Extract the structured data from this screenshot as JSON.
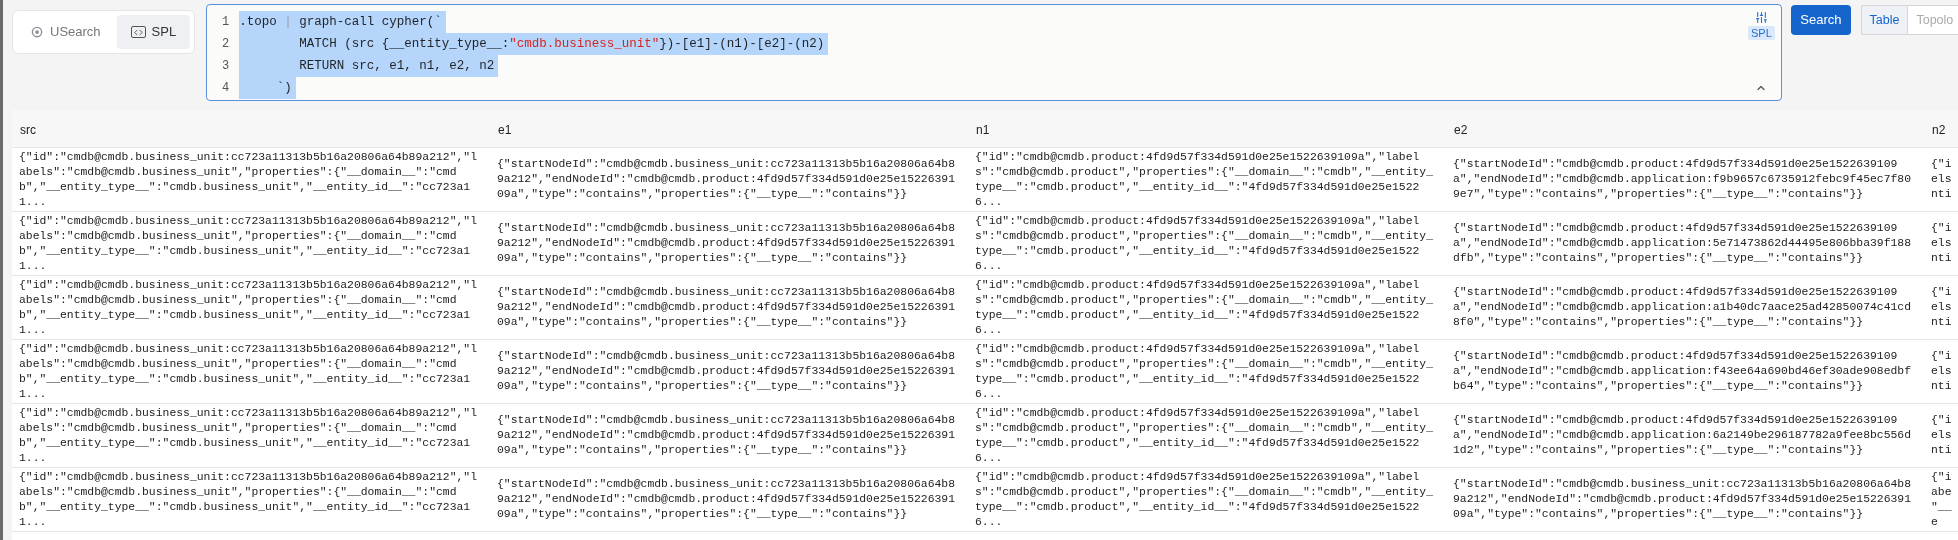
{
  "mode_tabs": [
    {
      "label": "USearch",
      "selected": false
    },
    {
      "label": "SPL",
      "selected": true
    }
  ],
  "editor": {
    "selected": true,
    "badge": "SPL",
    "line_numbers": [
      "1",
      "2",
      "3",
      "4"
    ],
    "lines": [
      [
        {
          "kind": "plain",
          "text": ".topo "
        },
        {
          "kind": "muted",
          "text": "|"
        },
        {
          "kind": "plain",
          "text": " graph-call cypher(`"
        }
      ],
      [
        {
          "kind": "plain",
          "text": "        MATCH (src {__entity_type__:"
        },
        {
          "kind": "string",
          "text": "\"cmdb.business_unit\""
        },
        {
          "kind": "plain",
          "text": "})-[e1]-(n1)-[e2]-(n2)"
        }
      ],
      [
        {
          "kind": "plain",
          "text": "        RETURN src, e1, n1, e2, n2"
        }
      ],
      [
        {
          "kind": "plain",
          "text": "     `)"
        }
      ]
    ]
  },
  "search_button": "Search",
  "view_tabs": [
    {
      "label": "Table",
      "selected": true
    },
    {
      "label": "Topolo",
      "selected": false
    }
  ],
  "table": {
    "columns": [
      "src",
      "e1",
      "n1",
      "e2",
      "n2"
    ],
    "rows": [
      [
        "{\"id\":\"cmdb@cmdb.business_unit:cc723a11313b5b16a20806a64b89a212\",\"labels\":\"cmdb@cmdb.business_unit\",\"properties\":{\"__domain__\":\"cmdb\",\"__entity_type__\":\"cmdb.business_unit\",\"__entity_id__\":\"cc723a11...",
        "{\"startNodeId\":\"cmdb@cmdb.business_unit:cc723a11313b5b16a20806a64b89a212\",\"endNodeId\":\"cmdb@cmdb.product:4fd9d57f334d591d0e25e1522639109a\",\"type\":\"contains\",\"properties\":{\"__type__\":\"contains\"}}",
        "{\"id\":\"cmdb@cmdb.product:4fd9d57f334d591d0e25e1522639109a\",\"labels\":\"cmdb@cmdb.product\",\"properties\":{\"__domain__\":\"cmdb\",\"__entity_type__\":\"cmdb.product\",\"__entity_id__\":\"4fd9d57f334d591d0e25e15226...",
        "{\"startNodeId\":\"cmdb@cmdb.product:4fd9d57f334d591d0e25e1522639109a\",\"endNodeId\":\"cmdb@cmdb.application:f9b9657c6735912febc9f45ec7f809e7\",\"type\":\"contains\",\"properties\":{\"__type__\":\"contains\"}}",
        "{\"i\nels\nnti"
      ],
      [
        "{\"id\":\"cmdb@cmdb.business_unit:cc723a11313b5b16a20806a64b89a212\",\"labels\":\"cmdb@cmdb.business_unit\",\"properties\":{\"__domain__\":\"cmdb\",\"__entity_type__\":\"cmdb.business_unit\",\"__entity_id__\":\"cc723a11...",
        "{\"startNodeId\":\"cmdb@cmdb.business_unit:cc723a11313b5b16a20806a64b89a212\",\"endNodeId\":\"cmdb@cmdb.product:4fd9d57f334d591d0e25e1522639109a\",\"type\":\"contains\",\"properties\":{\"__type__\":\"contains\"}}",
        "{\"id\":\"cmdb@cmdb.product:4fd9d57f334d591d0e25e1522639109a\",\"labels\":\"cmdb@cmdb.product\",\"properties\":{\"__domain__\":\"cmdb\",\"__entity_type__\":\"cmdb.product\",\"__entity_id__\":\"4fd9d57f334d591d0e25e15226...",
        "{\"startNodeId\":\"cmdb@cmdb.product:4fd9d57f334d591d0e25e1522639109a\",\"endNodeId\":\"cmdb@cmdb.application:5e71473862d44495e806bba39f188dfb\",\"type\":\"contains\",\"properties\":{\"__type__\":\"contains\"}}",
        "{\"i\nels\nnti"
      ],
      [
        "{\"id\":\"cmdb@cmdb.business_unit:cc723a11313b5b16a20806a64b89a212\",\"labels\":\"cmdb@cmdb.business_unit\",\"properties\":{\"__domain__\":\"cmdb\",\"__entity_type__\":\"cmdb.business_unit\",\"__entity_id__\":\"cc723a11...",
        "{\"startNodeId\":\"cmdb@cmdb.business_unit:cc723a11313b5b16a20806a64b89a212\",\"endNodeId\":\"cmdb@cmdb.product:4fd9d57f334d591d0e25e1522639109a\",\"type\":\"contains\",\"properties\":{\"__type__\":\"contains\"}}",
        "{\"id\":\"cmdb@cmdb.product:4fd9d57f334d591d0e25e1522639109a\",\"labels\":\"cmdb@cmdb.product\",\"properties\":{\"__domain__\":\"cmdb\",\"__entity_type__\":\"cmdb.product\",\"__entity_id__\":\"4fd9d57f334d591d0e25e15226...",
        "{\"startNodeId\":\"cmdb@cmdb.product:4fd9d57f334d591d0e25e1522639109a\",\"endNodeId\":\"cmdb@cmdb.application:a1b40dc7aace25ad42850074c41cd8f0\",\"type\":\"contains\",\"properties\":{\"__type__\":\"contains\"}}",
        "{\"i\nels\nnti"
      ],
      [
        "{\"id\":\"cmdb@cmdb.business_unit:cc723a11313b5b16a20806a64b89a212\",\"labels\":\"cmdb@cmdb.business_unit\",\"properties\":{\"__domain__\":\"cmdb\",\"__entity_type__\":\"cmdb.business_unit\",\"__entity_id__\":\"cc723a11...",
        "{\"startNodeId\":\"cmdb@cmdb.business_unit:cc723a11313b5b16a20806a64b89a212\",\"endNodeId\":\"cmdb@cmdb.product:4fd9d57f334d591d0e25e1522639109a\",\"type\":\"contains\",\"properties\":{\"__type__\":\"contains\"}}",
        "{\"id\":\"cmdb@cmdb.product:4fd9d57f334d591d0e25e1522639109a\",\"labels\":\"cmdb@cmdb.product\",\"properties\":{\"__domain__\":\"cmdb\",\"__entity_type__\":\"cmdb.product\",\"__entity_id__\":\"4fd9d57f334d591d0e25e15226...",
        "{\"startNodeId\":\"cmdb@cmdb.product:4fd9d57f334d591d0e25e1522639109a\",\"endNodeId\":\"cmdb@cmdb.application:f43ee64a690bd46ef30ade908edbfb64\",\"type\":\"contains\",\"properties\":{\"__type__\":\"contains\"}}",
        "{\"i\nels\nnti"
      ],
      [
        "{\"id\":\"cmdb@cmdb.business_unit:cc723a11313b5b16a20806a64b89a212\",\"labels\":\"cmdb@cmdb.business_unit\",\"properties\":{\"__domain__\":\"cmdb\",\"__entity_type__\":\"cmdb.business_unit\",\"__entity_id__\":\"cc723a11...",
        "{\"startNodeId\":\"cmdb@cmdb.business_unit:cc723a11313b5b16a20806a64b89a212\",\"endNodeId\":\"cmdb@cmdb.product:4fd9d57f334d591d0e25e1522639109a\",\"type\":\"contains\",\"properties\":{\"__type__\":\"contains\"}}",
        "{\"id\":\"cmdb@cmdb.product:4fd9d57f334d591d0e25e1522639109a\",\"labels\":\"cmdb@cmdb.product\",\"properties\":{\"__domain__\":\"cmdb\",\"__entity_type__\":\"cmdb.product\",\"__entity_id__\":\"4fd9d57f334d591d0e25e15226...",
        "{\"startNodeId\":\"cmdb@cmdb.product:4fd9d57f334d591d0e25e1522639109a\",\"endNodeId\":\"cmdb@cmdb.application:6a2149be296187782a9fee8bc556d1d2\",\"type\":\"contains\",\"properties\":{\"__type__\":\"contains\"}}",
        "{\"i\nels\nnti"
      ],
      [
        "{\"id\":\"cmdb@cmdb.business_unit:cc723a11313b5b16a20806a64b89a212\",\"labels\":\"cmdb@cmdb.business_unit\",\"properties\":{\"__domain__\":\"cmdb\",\"__entity_type__\":\"cmdb.business_unit\",\"__entity_id__\":\"cc723a11...",
        "{\"startNodeId\":\"cmdb@cmdb.business_unit:cc723a11313b5b16a20806a64b89a212\",\"endNodeId\":\"cmdb@cmdb.product:4fd9d57f334d591d0e25e1522639109a\",\"type\":\"contains\",\"properties\":{\"__type__\":\"contains\"}}",
        "{\"id\":\"cmdb@cmdb.product:4fd9d57f334d591d0e25e1522639109a\",\"labels\":\"cmdb@cmdb.product\",\"properties\":{\"__domain__\":\"cmdb\",\"__entity_type__\":\"cmdb.product\",\"__entity_id__\":\"4fd9d57f334d591d0e25e15226...",
        "{\"startNodeId\":\"cmdb@cmdb.business_unit:cc723a11313b5b16a20806a64b89a212\",\"endNodeId\":\"cmdb@cmdb.product:4fd9d57f334d591d0e25e1522639109a\",\"type\":\"contains\",\"properties\":{\"__type__\":\"contains\"}}",
        "{\"i\nabe\n\"__e"
      ]
    ]
  }
}
